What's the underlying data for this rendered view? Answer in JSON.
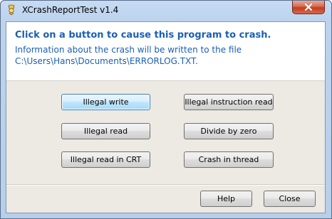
{
  "window": {
    "title": "XCrashReportTest v1.4"
  },
  "header": {
    "headline": "Click on a button to cause this program to crash.",
    "info_line1": "Information about the crash will be written to the file",
    "info_line2": "C:\\Users\\Hans\\Documents\\ERRORLOG.TXT."
  },
  "buttons": {
    "illegal_write": "Illegal write",
    "illegal_instruction_read": "Illegal instruction read",
    "illegal_read": "Illegal read",
    "divide_by_zero": "Divide by zero",
    "illegal_read_crt": "Illegal read in CRT",
    "crash_in_thread": "Crash in thread",
    "help": "Help",
    "close": "Close"
  },
  "icons": {
    "app": "crash-report-app-icon",
    "close": "close-icon"
  },
  "colors": {
    "headline": "#1a5fb4",
    "focused_button": "#bee6fd",
    "close_button": "#c23d1f"
  }
}
